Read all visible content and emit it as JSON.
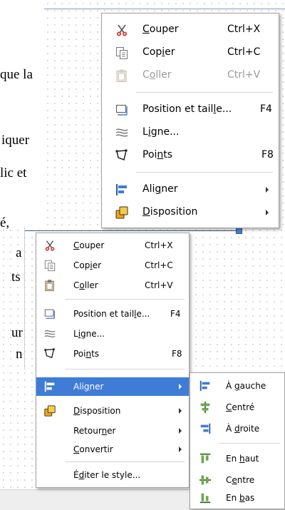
{
  "document": {
    "text_fragments": [
      "que la",
      "iquer",
      "lic et",
      "é,",
      "a",
      "ts",
      "ur",
      "n"
    ]
  },
  "menu_top": {
    "items": [
      {
        "pre": "",
        "key": "C",
        "post": "ouper",
        "accel": "Ctrl+X",
        "icon": "scissors-icon"
      },
      {
        "pre": "Cop",
        "key": "i",
        "post": "er",
        "accel": "Ctrl+C",
        "icon": "copy-icon"
      },
      {
        "pre": "C",
        "key": "o",
        "post": "ller",
        "accel": "Ctrl+V",
        "icon": "paste-icon"
      },
      {
        "pre": "Position et tail",
        "key": "l",
        "post": "e...",
        "accel": "F4",
        "icon": "position-size-icon"
      },
      {
        "pre": "L",
        "key": "i",
        "post": "gne...",
        "accel": "",
        "icon": "line-icon"
      },
      {
        "pre": "Poi",
        "key": "n",
        "post": "ts",
        "accel": "F8",
        "icon": "points-icon"
      },
      {
        "pre": "Ali",
        "key": "g",
        "post": "ner",
        "accel": "",
        "icon": "align-icon"
      },
      {
        "pre": "",
        "key": "D",
        "post": "isposition",
        "accel": "",
        "icon": "arrange-icon"
      }
    ]
  },
  "menu_main": {
    "items": [
      {
        "pre": "",
        "key": "C",
        "post": "ouper",
        "accel": "Ctrl+X",
        "icon": "scissors-icon"
      },
      {
        "pre": "Cop",
        "key": "i",
        "post": "er",
        "accel": "Ctrl+C",
        "icon": "copy-icon"
      },
      {
        "pre": "C",
        "key": "o",
        "post": "ller",
        "accel": "Ctrl+V",
        "icon": "paste-icon"
      },
      {
        "pre": "Position et tail",
        "key": "l",
        "post": "e...",
        "accel": "F4",
        "icon": "position-size-icon"
      },
      {
        "pre": "L",
        "key": "i",
        "post": "gne...",
        "accel": "",
        "icon": "line-icon"
      },
      {
        "pre": "Poi",
        "key": "n",
        "post": "ts",
        "accel": "F8",
        "icon": "points-icon"
      },
      {
        "pre": "Ali",
        "key": "g",
        "post": "ner",
        "accel": "",
        "icon": "align-icon"
      },
      {
        "pre": "",
        "key": "D",
        "post": "isposition",
        "accel": "",
        "icon": "arrange-icon"
      },
      {
        "pre": "Retour",
        "key": "n",
        "post": "er",
        "accel": "",
        "icon": ""
      },
      {
        "pre": "",
        "key": "C",
        "post": "onvertir",
        "accel": "",
        "icon": ""
      },
      {
        "pre": "É",
        "key": "d",
        "post": "iter le style...",
        "accel": "",
        "icon": ""
      }
    ]
  },
  "submenu_align": {
    "items": [
      {
        "pre": "À ",
        "key": "g",
        "post": "auche",
        "icon": "align-left-icon"
      },
      {
        "pre": "",
        "key": "C",
        "post": "entré",
        "icon": "align-center-icon"
      },
      {
        "pre": "À ",
        "key": "d",
        "post": "roite",
        "icon": "align-right-icon"
      },
      {
        "pre": "En ",
        "key": "h",
        "post": "aut",
        "icon": "align-top-icon"
      },
      {
        "pre": "C",
        "key": "e",
        "post": "ntre",
        "icon": "align-middle-icon"
      },
      {
        "pre": "En ",
        "key": "b",
        "post": "as",
        "icon": "align-bottom-icon"
      }
    ]
  },
  "colors": {
    "highlight": "#3f7cd8",
    "selection_handle": "#4a7fd0",
    "disabled_text": "#9a9a9a"
  }
}
